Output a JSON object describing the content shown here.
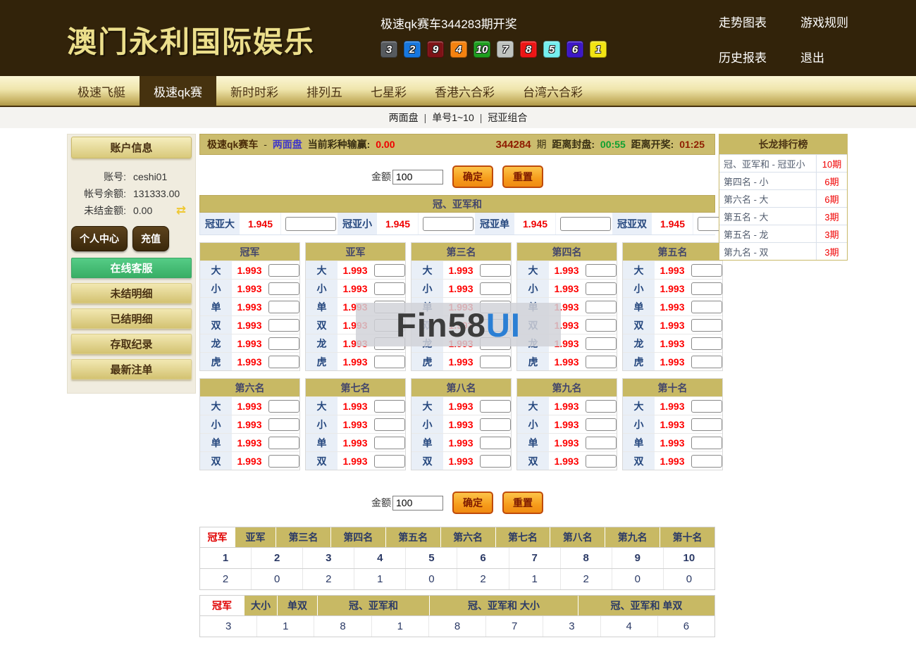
{
  "icons": {
    "refresh": "⇄"
  },
  "header": {
    "logo": "澳门永利国际娱乐",
    "draw_title": "极速qk赛车344283期开奖",
    "balls": [
      {
        "n": "3",
        "color": "#565A5E"
      },
      {
        "n": "2",
        "color": "#1677DF"
      },
      {
        "n": "9",
        "color": "#7E1216"
      },
      {
        "n": "4",
        "color": "#F5820F"
      },
      {
        "n": "10",
        "color": "#1D9E1D"
      },
      {
        "n": "7",
        "color": "#BFC3BF"
      },
      {
        "n": "8",
        "color": "#EE1515"
      },
      {
        "n": "5",
        "color": "#74EFEF"
      },
      {
        "n": "6",
        "color": "#3D17C6"
      },
      {
        "n": "1",
        "color": "#F2E412"
      }
    ],
    "links": [
      "走势图表",
      "游戏规则",
      "历史报表",
      "退出"
    ]
  },
  "nav": {
    "tabs": [
      {
        "label": "极速飞艇",
        "active": false
      },
      {
        "label": "极速qk赛",
        "active": true
      },
      {
        "label": "新时时彩",
        "active": false
      },
      {
        "label": "排列五",
        "active": false
      },
      {
        "label": "七星彩",
        "active": false
      },
      {
        "label": "香港六合彩",
        "active": false
      },
      {
        "label": "台湾六合彩",
        "active": false
      }
    ]
  },
  "subnav": {
    "items": [
      "两面盘",
      "单号1~10",
      "冠亚组合"
    ],
    "divider": "|"
  },
  "sidebar": {
    "account_header": "账户信息",
    "fields": [
      {
        "label": "账号:",
        "value": "ceshi01"
      },
      {
        "label": "帐号余额:",
        "value": "131333.00"
      },
      {
        "label": "未结金额:",
        "value": "0.00",
        "refresh": true
      }
    ],
    "small_buttons": [
      "个人中心",
      "充值"
    ],
    "menu_buttons": [
      {
        "label": "在线客服",
        "style": "green"
      },
      {
        "label": "未结明细",
        "style": "gold"
      },
      {
        "label": "已结明细",
        "style": "gold"
      },
      {
        "label": "存取纪录",
        "style": "gold"
      },
      {
        "label": "最新注单",
        "style": "gold"
      }
    ]
  },
  "main": {
    "info_bar": {
      "game": "极速qk赛车",
      "dash": "-",
      "mode": "两面盘",
      "winloss_label": "当前彩种输赢:",
      "winloss_value": "0.00",
      "issue": "344284",
      "issue_suffix": "期",
      "close_label": "距离封盘:",
      "close_value": "00:55",
      "draw_label": "距离开奖:",
      "draw_value": "01:25"
    },
    "amount": {
      "label": "金额",
      "value": "100",
      "confirm": "确定",
      "reset": "重置"
    },
    "sum_section": {
      "title": "冠、亚军和",
      "items": [
        {
          "label": "冠亚大",
          "odds": "1.945"
        },
        {
          "label": "冠亚小",
          "odds": "1.945"
        },
        {
          "label": "冠亚单",
          "odds": "1.945"
        },
        {
          "label": "冠亚双",
          "odds": "1.945"
        }
      ]
    },
    "bet_tables_row1": [
      {
        "title": "冠军",
        "odds": "1.993",
        "options": [
          "大",
          "小",
          "单",
          "双",
          "龙",
          "虎"
        ]
      },
      {
        "title": "亚军",
        "odds": "1.993",
        "options": [
          "大",
          "小",
          "单",
          "双",
          "龙",
          "虎"
        ]
      },
      {
        "title": "第三名",
        "odds": "1.993",
        "options": [
          "大",
          "小",
          "单",
          "双",
          "龙",
          "虎"
        ]
      },
      {
        "title": "第四名",
        "odds": "1.993",
        "options": [
          "大",
          "小",
          "单",
          "双",
          "龙",
          "虎"
        ]
      },
      {
        "title": "第五名",
        "odds": "1.993",
        "options": [
          "大",
          "小",
          "单",
          "双",
          "龙",
          "虎"
        ]
      }
    ],
    "bet_tables_row2": [
      {
        "title": "第六名",
        "odds": "1.993",
        "options": [
          "大",
          "小",
          "单",
          "双"
        ]
      },
      {
        "title": "第七名",
        "odds": "1.993",
        "options": [
          "大",
          "小",
          "单",
          "双"
        ]
      },
      {
        "title": "第八名",
        "odds": "1.993",
        "options": [
          "大",
          "小",
          "单",
          "双"
        ]
      },
      {
        "title": "第九名",
        "odds": "1.993",
        "options": [
          "大",
          "小",
          "单",
          "双"
        ]
      },
      {
        "title": "第十名",
        "odds": "1.993",
        "options": [
          "大",
          "小",
          "单",
          "双"
        ]
      }
    ],
    "number_board": {
      "tabs": [
        "冠军",
        "亚军",
        "第三名",
        "第四名",
        "第五名",
        "第六名",
        "第七名",
        "第八名",
        "第九名",
        "第十名"
      ],
      "active_tab": "冠军",
      "numbers": [
        "1",
        "2",
        "3",
        "4",
        "5",
        "6",
        "7",
        "8",
        "9",
        "10"
      ],
      "counts": [
        "2",
        "0",
        "2",
        "1",
        "0",
        "2",
        "1",
        "2",
        "0",
        "0"
      ]
    },
    "two_side_board": {
      "headers": [
        {
          "label": "冠军",
          "active": true
        },
        {
          "label": "大小",
          "active": false
        },
        {
          "label": "单双",
          "active": false
        },
        {
          "label": "冠、亚军和",
          "active": false
        },
        {
          "label": "冠、亚军和 大小",
          "active": false
        },
        {
          "label": "冠、亚军和 单双",
          "active": false
        }
      ],
      "values": [
        "3",
        "1",
        "8",
        "1",
        "8",
        "7",
        "3",
        "4",
        "6"
      ]
    }
  },
  "rank_panel": {
    "title": "长龙排行榜",
    "rows": [
      {
        "name": "冠、亚军和 - 冠亚小",
        "count": "10期"
      },
      {
        "name": "第四名 - 小",
        "count": "6期"
      },
      {
        "name": "第六名 - 大",
        "count": "6期"
      },
      {
        "name": "第五名 - 大",
        "count": "3期"
      },
      {
        "name": "第五名 - 龙",
        "count": "3期"
      },
      {
        "name": "第九名 - 双",
        "count": "3期"
      }
    ]
  },
  "watermark": {
    "part1": "Fin58",
    "part2": "UI"
  }
}
